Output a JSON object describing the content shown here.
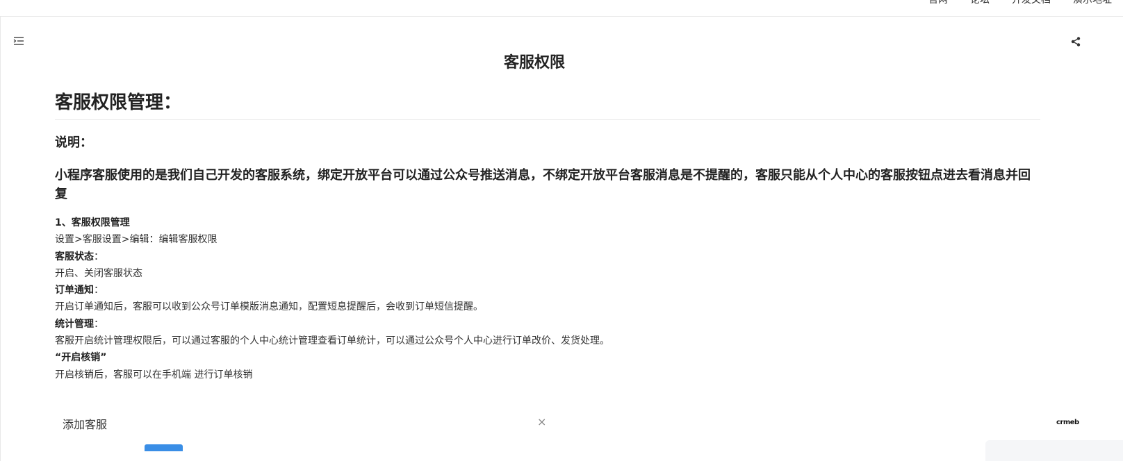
{
  "top_nav": {
    "items": [
      "官网",
      "论坛",
      "开发文档",
      "演示地址"
    ]
  },
  "doc": {
    "title": "客服权限",
    "heading": "客服权限管理：",
    "note_label": "说明：",
    "lead": "小程序客服使用的是我们自己开发的客服系统，绑定开放平台可以通过公众号推送消息，不绑定开放平台客服消息是不提醒的，客服只能从个人中心的客服按钮点进去看消息并回复",
    "section1_title": "1、客服权限管理",
    "path": "设置>客服设置>编辑：编辑客服权限",
    "status_label": "客服状态",
    "status_colon": "：",
    "status_desc": "开启、关闭客服状态",
    "order_label": "订单通知",
    "order_colon": "：",
    "order_desc": "开启订单通知后，客服可以收到公众号订单模版消息通知，配置短息提醒后，会收到订单短信提醒。",
    "stats_label": "统计管理",
    "stats_colon": "：",
    "stats_desc": "客服开启统计管理权限后，可以通过客服的个人中心统计管理查看订单统计，可以通过公众号个人中心进行订单改价、发货处理。",
    "verify_label": "“开启核销”",
    "verify_desc": "开启核销后，客服可以在手机端 进行订单核销"
  },
  "popup": {
    "title": "添加客服",
    "close": "×"
  },
  "brand": {
    "logo_text": "crmeb"
  },
  "icons": {
    "toc": "list-indent-icon",
    "share": "share-icon",
    "close": "close-icon"
  }
}
